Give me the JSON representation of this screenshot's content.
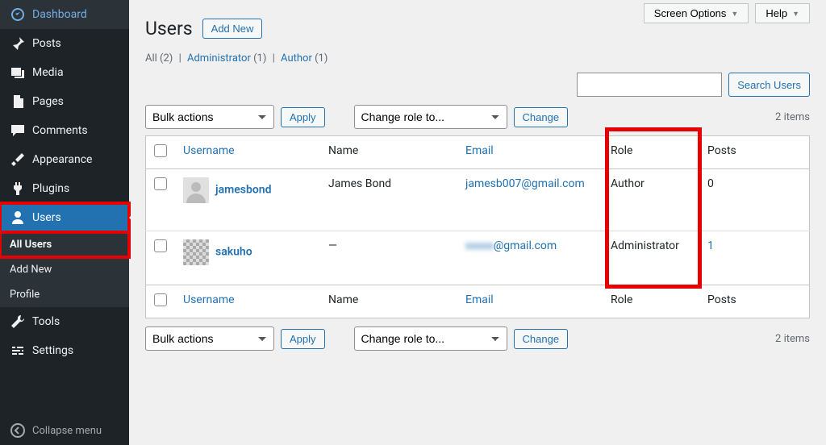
{
  "sidebar": {
    "items": [
      {
        "label": "Dashboard"
      },
      {
        "label": "Posts"
      },
      {
        "label": "Media"
      },
      {
        "label": "Pages"
      },
      {
        "label": "Comments"
      },
      {
        "label": "Appearance"
      },
      {
        "label": "Plugins"
      },
      {
        "label": "Users"
      },
      {
        "label": "Tools"
      },
      {
        "label": "Settings"
      }
    ],
    "submenu": {
      "all_users": "All Users",
      "add_new": "Add New",
      "profile": "Profile"
    },
    "collapse": "Collapse menu"
  },
  "topbar": {
    "screen_options": "Screen Options",
    "help": "Help"
  },
  "header": {
    "title": "Users",
    "add_new": "Add New"
  },
  "filters": {
    "all_label": "All",
    "all_count": "(2)",
    "admin_label": "Administrator",
    "admin_count": "(1)",
    "author_label": "Author",
    "author_count": "(1)"
  },
  "search": {
    "button": "Search Users"
  },
  "actions": {
    "bulk_label": "Bulk actions",
    "apply": "Apply",
    "role_label": "Change role to...",
    "change": "Change",
    "items": "2 items"
  },
  "table": {
    "cols": {
      "username": "Username",
      "name": "Name",
      "email": "Email",
      "role": "Role",
      "posts": "Posts"
    },
    "rows": [
      {
        "username": "jamesbond",
        "name": "James Bond",
        "email": "jamesb007@gmail.com",
        "email_blur": "",
        "role": "Author",
        "posts": "0",
        "avatar": "generic"
      },
      {
        "username": "sakuho",
        "name": "—",
        "email": "@gmail.com",
        "email_blur": "xxxxx",
        "role": "Administrator",
        "posts": "1",
        "avatar": "pixel"
      }
    ]
  }
}
